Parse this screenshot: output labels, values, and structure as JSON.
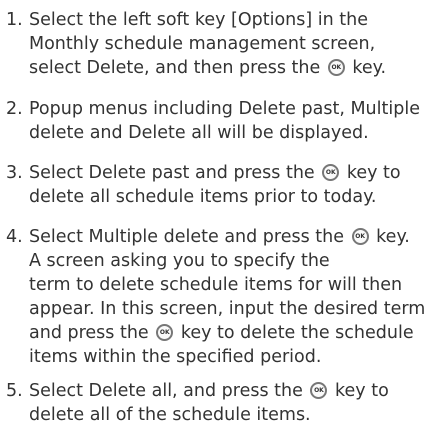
{
  "steps": [
    {
      "number": "1.",
      "lines": [
        [
          "Select the left soft key [Options] in the"
        ],
        [
          "Monthly schedule management screen,"
        ],
        [
          "select Delete, and then press the",
          "ok-key-icon",
          "key."
        ]
      ]
    },
    {
      "number": "2.",
      "lines": [
        [
          "Popup menus including Delete past, Multiple"
        ],
        [
          "delete and Delete all will be displayed."
        ]
      ]
    },
    {
      "number": "3.",
      "lines": [
        [
          "Select Delete past and press the",
          "ok-key-icon",
          "key to"
        ],
        [
          "delete all schedule items prior to today."
        ]
      ]
    },
    {
      "number": "4.",
      "lines": [
        [
          "Select Multiple delete and press the",
          "ok-key-icon",
          "key."
        ],
        [
          "A screen asking you to specify the"
        ],
        [
          "term to delete schedule items for will then"
        ],
        [
          "appear. In this screen, input the desired term"
        ],
        [
          "and press the",
          "ok-key-icon",
          "key to delete the schedule"
        ],
        [
          "items within the specified period."
        ]
      ]
    },
    {
      "number": "5.",
      "lines": [
        [
          "Select Delete all, and press the",
          "ok-key-icon",
          "key to"
        ],
        [
          "delete all of the schedule items."
        ]
      ]
    }
  ]
}
